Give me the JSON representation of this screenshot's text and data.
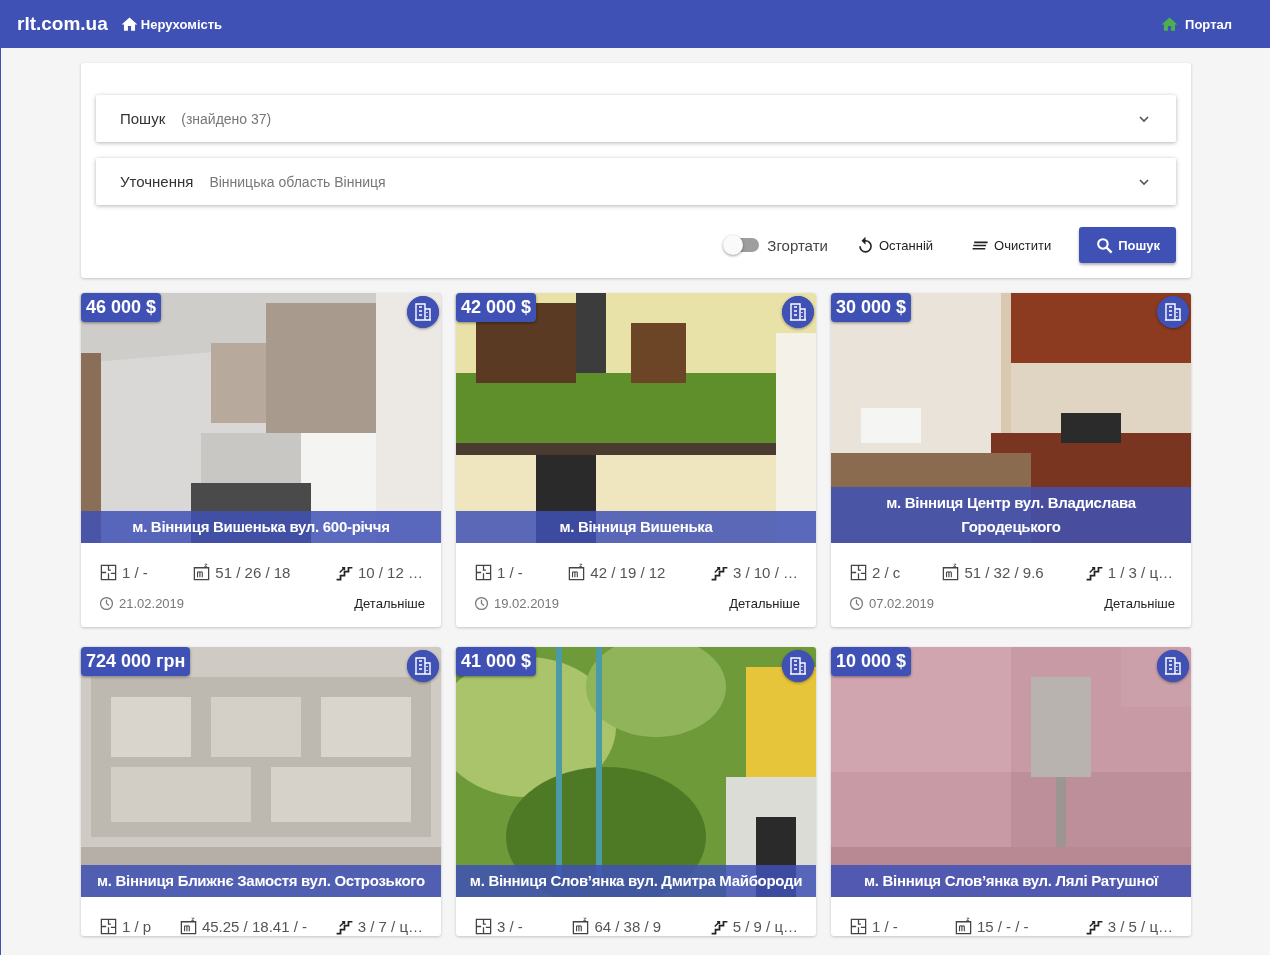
{
  "header": {
    "logo": "rlt.com.ua",
    "section": "Нерухомість",
    "portal": "Портал"
  },
  "search": {
    "panels": [
      {
        "title": "Пошук",
        "value": "(знайдено 37)",
        "expanded": false
      },
      {
        "title": "Уточнення",
        "value": "Вінницька область Вінниця",
        "expanded": false
      }
    ],
    "collapse_toggle": {
      "label": "Згортати",
      "on": false
    },
    "buttons": [
      {
        "kind": "recent",
        "label": "Останній"
      },
      {
        "kind": "clear",
        "label": "Очистити"
      },
      {
        "kind": "search",
        "label": "Пошук"
      }
    ]
  },
  "listings": [
    {
      "price": "46 000 $",
      "address": "м. Вінниця Вишенька вул. 600-річчя",
      "rooms": "1 / -",
      "area": "51 / 26 / 18",
      "floor": "10 / 12 …",
      "date": "21.02.2019",
      "details": "Детальніше"
    },
    {
      "price": "42 000 $",
      "address": "м. Вінниця Вишенька",
      "rooms": "1 / -",
      "area": "42 / 19 / 12",
      "floor": "3 / 10 / …",
      "date": "19.02.2019",
      "details": "Детальніше"
    },
    {
      "price": "30 000 $",
      "address": "м. Вінниця Центр вул. Владислава Городецького",
      "rooms": "2 / с",
      "area": "51 / 32 / 9.6",
      "floor": "1 / 3 / ц…",
      "date": "07.02.2019",
      "details": "Детальніше"
    },
    {
      "price": "724 000 грн",
      "address": "м. Вінниця Ближнє Замостя вул. Острозького",
      "rooms": "1 / р",
      "area": "45.25 / 18.41 / -",
      "floor": "3 / 7 / ц…"
    },
    {
      "price": "41 000 $",
      "address": "м. Вінниця Слов’янка вул. Дмитра Майбороди",
      "rooms": "3 / -",
      "area": "64 / 38 / 9",
      "floor": "5 / 9 / ц…"
    },
    {
      "price": "10 000 $",
      "address": "м. Вінниця Слов’янка вул. Лялі Ратушної",
      "rooms": "1 / -",
      "area": "15 / - / -",
      "floor": "3 / 5 / ц…"
    }
  ]
}
